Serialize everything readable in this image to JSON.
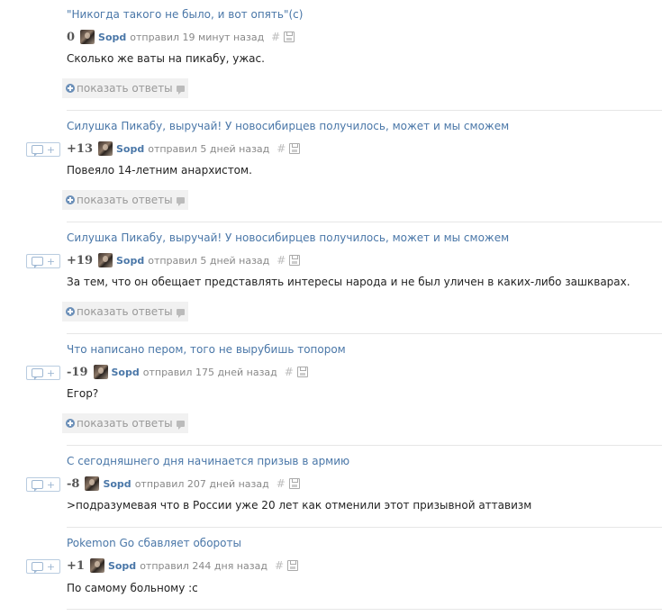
{
  "comments": [
    {
      "post_title": "\"Никогда такого не было, и вот опять\"(с)",
      "rating": "0",
      "author": "Sopd",
      "sent": "отправил 19 минут назад",
      "text": "Сколько же ваты на пикабу, ужас.",
      "show_replies": "показать ответы"
    },
    {
      "post_title": "Силушка Пикабу, выручай! У новосибирцев получилось, может и мы сможем",
      "rating": "+13",
      "author": "Sopd",
      "sent": "отправил 5 дней назад",
      "text": "Повеяло 14-летним анархистом.",
      "show_replies": "показать ответы"
    },
    {
      "post_title": "Силушка Пикабу, выручай! У новосибирцев получилось, может и мы сможем",
      "rating": "+19",
      "author": "Sopd",
      "sent": "отправил 5 дней назад",
      "text": "За тем, что он обещает представлять интересы народа и не был уличен в каких-либо зашкварах.",
      "show_replies": "показать ответы"
    },
    {
      "post_title": "Что написано пером, того не вырубишь топором",
      "rating": "-19",
      "author": "Sopd",
      "sent": "отправил 175 дней назад",
      "text": "Егор?",
      "show_replies": "показать ответы"
    },
    {
      "post_title": "С сегодняшнего дня начинается призыв в армию",
      "rating": "-8",
      "author": "Sopd",
      "sent": "отправил 207 дней назад",
      "text": ">подразумевая что в России уже 20 лет как отменили этот призывной аттавизм"
    },
    {
      "post_title": "Pokemon Go сбавляет обороты",
      "rating": "+1",
      "author": "Sopd",
      "sent": "отправил 244 дня назад",
      "text": "По самому больному :с"
    }
  ],
  "hash_symbol": "#",
  "reply_plus": "+",
  "colors": {
    "link": "#4a77a8",
    "meta": "#888888",
    "divider": "#e6e6e6"
  }
}
